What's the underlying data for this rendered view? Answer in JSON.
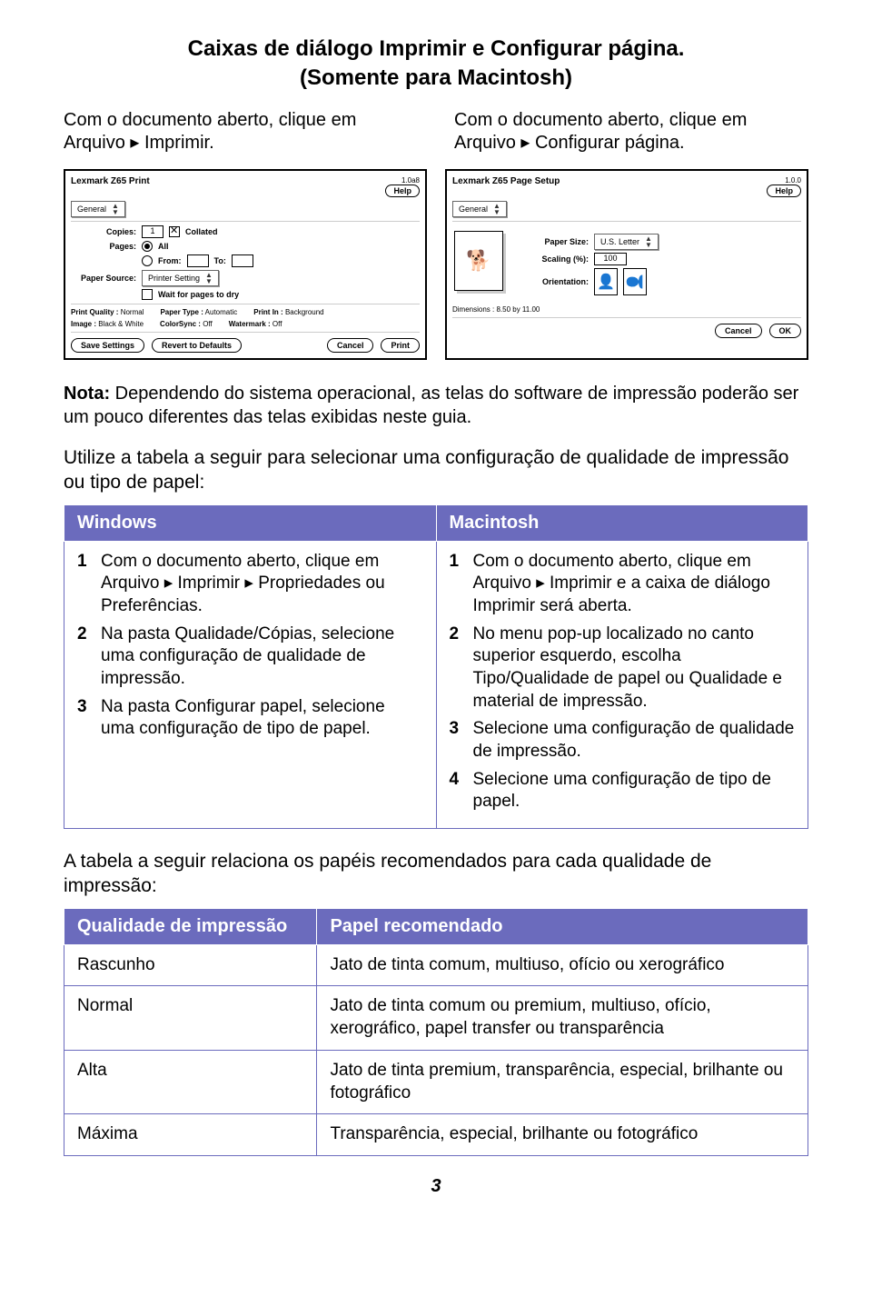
{
  "title": {
    "line1": "Caixas de diálogo Imprimir e Configurar página.",
    "line2": "(Somente para Macintosh)"
  },
  "left_intro": "Com o documento aberto, clique em Arquivo ▸ Imprimir.",
  "right_intro": "Com o documento aberto, clique em Arquivo ▸ Configurar página.",
  "print_dialog": {
    "title": "Lexmark Z65 Print",
    "version": "1.0a8",
    "help": "Help",
    "popup": "General",
    "copies_label": "Copies:",
    "copies_value": "1",
    "collated": "Collated",
    "pages_label": "Pages:",
    "all": "All",
    "from": "From:",
    "to": "To:",
    "source_label": "Paper Source:",
    "source_value": "Printer Setting",
    "wait": "Wait for pages to dry",
    "pq_label": "Print Quality :",
    "pq_value": "Normal",
    "pt_label": "Paper Type :",
    "pt_value": "Automatic",
    "pi_label": "Print In :",
    "pi_value": "Background",
    "ia_label": "Image :",
    "ia_value": "Black & White",
    "cs_label": "ColorSync :",
    "cs_value": "Off",
    "wm_label": "Watermark :",
    "wm_value": "Off",
    "save": "Save Settings",
    "revert": "Revert to Defaults",
    "cancel": "Cancel",
    "print": "Print"
  },
  "setup_dialog": {
    "title": "Lexmark Z65 Page Setup",
    "version": "1.0.0",
    "help": "Help",
    "popup": "General",
    "paper_size_label": "Paper Size:",
    "paper_size_value": "U.S. Letter",
    "scaling_label": "Scaling (%):",
    "scaling_value": "100",
    "orientation_label": "Orientation:",
    "dims": "Dimensions : 8.50 by 11.00",
    "cancel": "Cancel",
    "ok": "OK"
  },
  "nota_label": "Nota:",
  "nota_text": " Dependendo do sistema operacional, as telas do software de impressão poderão ser um pouco diferentes das telas exibidas neste guia.",
  "table_intro": "Utilize a tabela a seguir para selecionar uma configuração de qualidade de impressão ou tipo de papel:",
  "col_windows": "Windows",
  "col_mac": "Macintosh",
  "win_steps": [
    "Com o documento aberto, clique em Arquivo ▸ Imprimir ▸ Propriedades ou Preferências.",
    "Na pasta Qualidade/Cópias, selecione uma configuração de qualidade de impressão.",
    "Na pasta Configurar papel, selecione uma configuração de tipo de papel."
  ],
  "mac_steps": [
    "Com o documento aberto, clique em Arquivo ▸ Imprimir e a caixa de diálogo Imprimir será aberta.",
    "No menu pop-up localizado no canto superior esquerdo, escolha Tipo/Qualidade de papel ou Qualidade e material de impressão.",
    "Selecione uma configuração de qualidade de impressão.",
    "Selecione uma configuração de tipo de papel."
  ],
  "after_table": "A tabela a seguir relaciona os papéis recomendados para cada qualidade de impressão:",
  "qcol1": "Qualidade de impressão",
  "qcol2": "Papel recomendado",
  "quality_rows": [
    {
      "q": "Rascunho",
      "p": "Jato de tinta comum, multiuso, ofício ou xerográfico"
    },
    {
      "q": "Normal",
      "p": "Jato de tinta comum ou premium, multiuso, ofício, xerográfico, papel transfer ou transparência"
    },
    {
      "q": "Alta",
      "p": "Jato de tinta premium, transparência, especial, brilhante ou fotográfico"
    },
    {
      "q": "Máxima",
      "p": "Transparência, especial, brilhante ou fotográfico"
    }
  ],
  "pagenum": "3"
}
